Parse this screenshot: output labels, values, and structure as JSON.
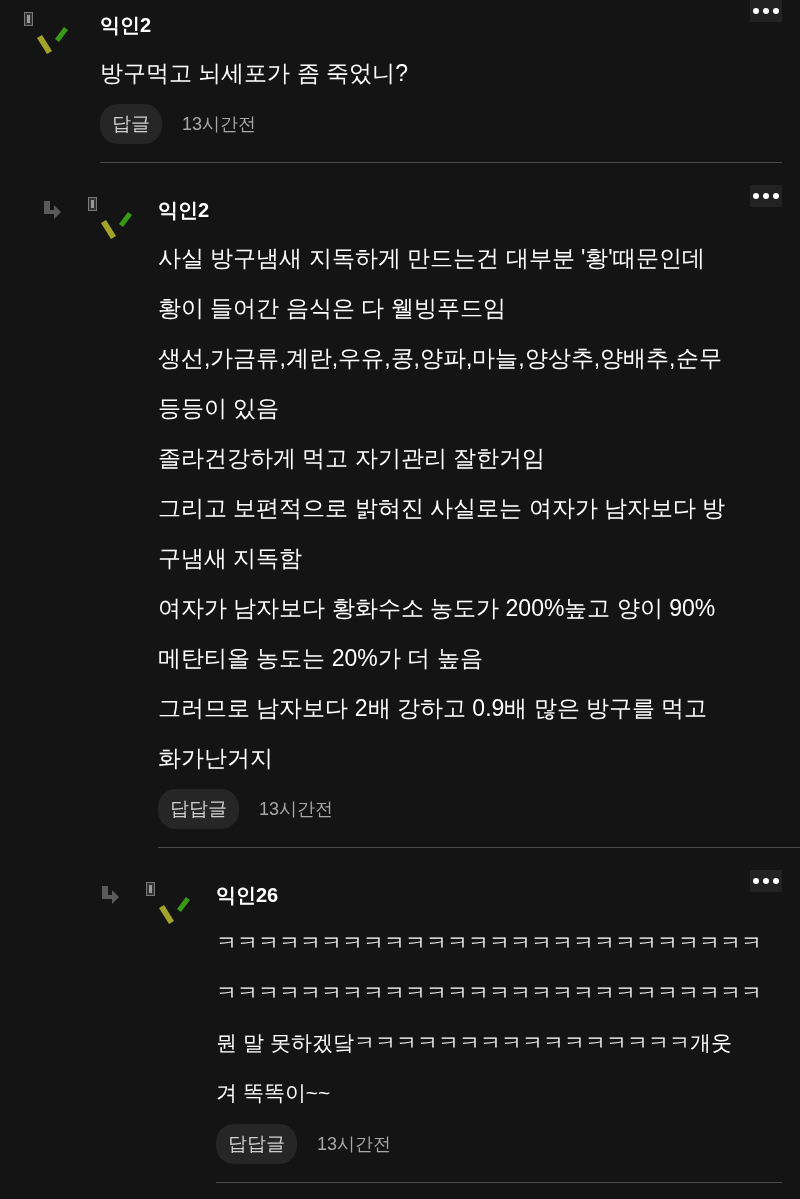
{
  "comments": [
    {
      "author": "익인2",
      "lines": [
        "방구먹고 뇌세포가 좀 죽었니?"
      ],
      "reply_label": "답글",
      "time": "13시간전",
      "children": [
        {
          "author": "익인2",
          "lines": [
            "사실 방구냄새 지독하게 만드는건 대부분 '황'때문인데",
            "황이 들어간 음식은 다 웰빙푸드임",
            "생선,가금류,계란,우유,콩,양파,마늘,양상추,양배추,순무",
            "등등이 있음",
            "졸라건강하게 먹고 자기관리 잘한거임",
            "그리고 보편적으로 밝혀진 사실로는 여자가 남자보다 방",
            "구냄새 지독함",
            "여자가 남자보다 황화수소 농도가 200%높고 양이 90%",
            "메탄티올 농도는 20%가 더 높음",
            "그러므로 남자보다 2배 강하고 0.9배 많은 방구를 먹고",
            "화가난거지"
          ],
          "reply_label": "답답글",
          "time": "13시간전",
          "children": [
            {
              "author": "익인26",
              "lines": [
                "ㅋㅋㅋㅋㅋㅋㅋㅋㅋㅋㅋㅋㅋㅋㅋㅋㅋㅋㅋㅋㅋㅋㅋㅋㅋㅋ",
                "ㅋㅋㅋㅋㅋㅋㅋㅋㅋㅋㅋㅋㅋㅋㅋㅋㅋㅋㅋㅋㅋㅋㅋㅋㅋㅋ",
                "뭔 말 못하겠닼ㅋㅋㅋㅋㅋㅋㅋㅋㅋㅋㅋㅋㅋㅋㅋㅋ개웃",
                "겨 똑똑이~~"
              ],
              "reply_label": "답답글",
              "time": "13시간전"
            }
          ]
        }
      ]
    }
  ]
}
